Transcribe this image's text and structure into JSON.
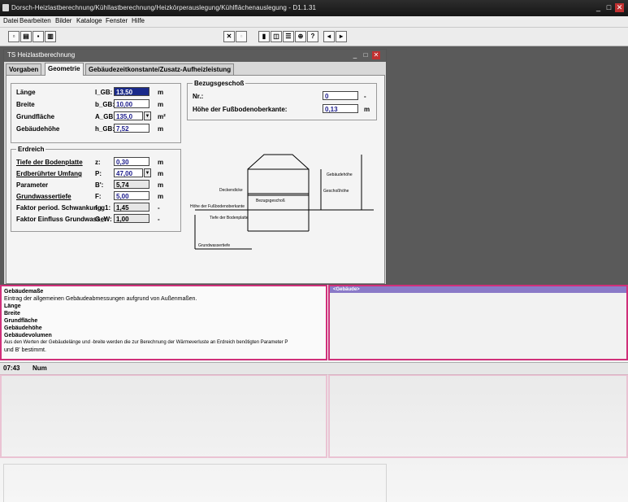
{
  "window": {
    "title": "Dorsch-Heizlastberechnung/Kühllastberechnung/Heizkörperauslegung/Kühlflächenauslegung - D1.1.31",
    "minimize": "_",
    "maximize": "□",
    "close": "✕"
  },
  "menu": [
    "Datei",
    "Bearbeiten",
    "Bilder",
    "Kataloge",
    "Fenster",
    "Hilfe"
  ],
  "child": {
    "title": "TS Heizlastberechnung",
    "tabs": [
      "Vorgaben",
      "Geometrie",
      "Gebäudezeitkonstante/Zusatz-Aufheizleistung"
    ],
    "active_tab": 1
  },
  "geometry": {
    "rows": [
      {
        "label": "Länge",
        "symbol": "l_GB:",
        "value": "13,50",
        "unit": "m"
      },
      {
        "label": "Breite",
        "symbol": "b_GB:",
        "value": "10,00",
        "unit": "m"
      },
      {
        "label": "Grundfläche",
        "symbol": "A_GB:",
        "value": "135,0",
        "unit": "m²"
      },
      {
        "label": "Gebäudehöhe",
        "symbol": "h_GB:",
        "value": "7,52",
        "unit": "m"
      }
    ]
  },
  "erdreich": {
    "title": "Erdreich",
    "rows": [
      {
        "label": "Tiefe der Bodenplatte",
        "symbol": "z:",
        "value": "0,30",
        "unit": "m"
      },
      {
        "label": "Erdberührter Umfang",
        "symbol": "P:",
        "value": "47,00",
        "unit": "m"
      },
      {
        "label": "Parameter",
        "symbol": "B':",
        "value": "5,74",
        "unit": "m"
      },
      {
        "label": "Grundwassertiefe",
        "symbol": "F:",
        "value": "5,00",
        "unit": "m"
      },
      {
        "label": "Faktor period. Schwankung",
        "symbol": "f_g1:",
        "value": "1,45",
        "unit": "-"
      },
      {
        "label": "Faktor Einfluss Grundwasser",
        "symbol": "G_W:",
        "value": "1,00",
        "unit": "-"
      }
    ]
  },
  "bezug": {
    "title": "Bezugsgeschoß",
    "rows": [
      {
        "label": "Nr.:",
        "value": "0",
        "unit": "-"
      },
      {
        "label": "Höhe der Fußbodenoberkante:",
        "value": "0,13",
        "unit": "m"
      }
    ]
  },
  "diagram": {
    "gebaeudehoehe": "Gebäudehöhe",
    "geschosshoehe": "Geschoßhöhe",
    "deckendicke": "Deckendicke",
    "bezugsgeschoss": "Bezugsgeschoß",
    "fussboden": "Höhe der Fußbodenoberkante",
    "tiefe": "Tiefe der Bodenplatte",
    "grundwasser": "Grundwassertiefe"
  },
  "help": {
    "lines": [
      {
        "text": "Gebäudemaße",
        "bold": true
      },
      {
        "text": "Eintrag der allgemeinen Gebäudeabmessungen aufgrund von Außenmaßen.",
        "bold": false
      },
      {
        "text": "Länge",
        "bold": true
      },
      {
        "text": "Breite",
        "bold": true
      },
      {
        "text": "Grundfläche",
        "bold": true
      },
      {
        "text": "Gebäudehöhe",
        "bold": true
      },
      {
        "text": "Gebäudevolumen",
        "bold": true
      },
      {
        "text": "Aus den Werten der Gebäudelänge und -breite werden die zur Berechnung der Wärmeverluste an Erdreich benötigten Parameter P",
        "bold": false
      },
      {
        "text": "und B' bestimmt.",
        "bold": false
      }
    ]
  },
  "right_panel": {
    "header": "<Gebäude>"
  },
  "status": {
    "time": "07:43",
    "mode": "Num"
  },
  "colors": {
    "accent": "#d0307a",
    "title": "#151515",
    "mdi": "#5a5a5a",
    "selected": "#1a2a8a"
  }
}
